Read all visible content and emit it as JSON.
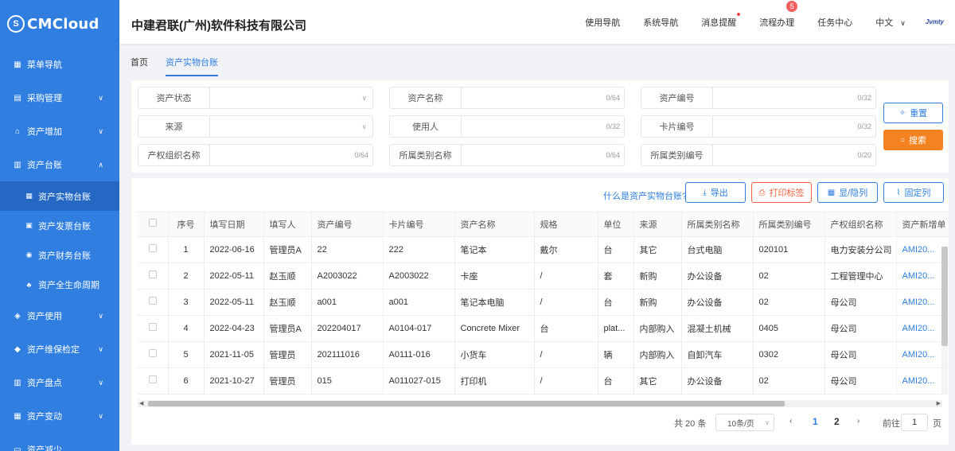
{
  "brand": {
    "logo_text": "CMCloud",
    "logo_mark": "S"
  },
  "sidebar": {
    "items": [
      {
        "label": "菜单导航",
        "icon": "grid-icon"
      },
      {
        "label": "采购管理",
        "icon": "clipboard-icon"
      },
      {
        "label": "资产增加",
        "icon": "home-icon"
      },
      {
        "label": "资产台账",
        "icon": "ledger-icon"
      },
      {
        "label": "资产使用",
        "icon": "layers-icon"
      },
      {
        "label": "资产维保检定",
        "icon": "cube-icon"
      },
      {
        "label": "资产盘点",
        "icon": "stack-icon"
      },
      {
        "label": "资产变动",
        "icon": "grid-icon"
      },
      {
        "label": "资产减少",
        "icon": "minus-icon"
      }
    ],
    "subitems": [
      {
        "label": "资产实物台账",
        "icon": "grid-icon",
        "active": true
      },
      {
        "label": "资产发票台账",
        "icon": "invoice-icon"
      },
      {
        "label": "资产财务台账",
        "icon": "money-icon"
      },
      {
        "label": "资产全生命周期",
        "icon": "tree-icon"
      }
    ]
  },
  "header": {
    "company": "中建君联(广州)软件科技有限公司",
    "nav": [
      "使用导航",
      "系统导航",
      "消息提醒",
      "流程办理",
      "任务中心"
    ],
    "process_badge": "5",
    "language": "中文",
    "partner_logo": "Jvmty"
  },
  "tabs": [
    "首页",
    "资产实物台账"
  ],
  "search": {
    "fields": [
      {
        "label": "资产状态",
        "type": "select"
      },
      {
        "label": "资产名称",
        "counter": "0/64"
      },
      {
        "label": "资产编号",
        "counter": "0/32"
      },
      {
        "label": "来源",
        "type": "select"
      },
      {
        "label": "使用人",
        "counter": "0/32"
      },
      {
        "label": "卡片编号",
        "counter": "0/32"
      },
      {
        "label": "产权组织名称",
        "counter": "0/64"
      },
      {
        "label": "所属类别名称",
        "counter": "0/64"
      },
      {
        "label": "所属类别编号",
        "counter": "0/20"
      }
    ],
    "reset_label": "重置",
    "search_label": "搜索"
  },
  "toolbar": {
    "help_link": "什么是资产实物台账?",
    "export_label": "导出",
    "print_label": "打印标签",
    "toggle_cols_label": "显/隐列",
    "fix_cols_label": "固定列"
  },
  "table": {
    "columns": [
      "序号",
      "填写日期",
      "填写人",
      "资产编号",
      "卡片编号",
      "资产名称",
      "规格",
      "单位",
      "来源",
      "所属类别名称",
      "所属类别编号",
      "产权组织名称",
      "资产新增单"
    ],
    "rows": [
      [
        "1",
        "2022-06-16",
        "管理员A",
        "22",
        "222",
        "笔记本",
        "戴尔",
        "台",
        "其它",
        "台式电脑",
        "020101",
        "电力安装分公司",
        "AMI20..."
      ],
      [
        "2",
        "2022-05-11",
        "赵玉顺",
        "A2003022",
        "A2003022",
        "卡座",
        "/",
        "套",
        "新购",
        "办公设备",
        "02",
        "工程管理中心",
        "AMI20..."
      ],
      [
        "3",
        "2022-05-11",
        "赵玉顺",
        "a001",
        "a001",
        "笔记本电脑",
        "/",
        "台",
        "新购",
        "办公设备",
        "02",
        "母公司",
        "AMI20..."
      ],
      [
        "4",
        "2022-04-23",
        "管理员A",
        "202204017",
        "A0104-017",
        "Concrete Mixer",
        "台",
        "plat...",
        "内部购入",
        "混凝土机械",
        "0405",
        "母公司",
        "AMI20..."
      ],
      [
        "5",
        "2021-11-05",
        "管理员",
        "202111016",
        "A0111-016",
        "小货车",
        "/",
        "辆",
        "内部购入",
        "自卸汽车",
        "0302",
        "母公司",
        "AMI20..."
      ],
      [
        "6",
        "2021-10-27",
        "管理员",
        "015",
        "A011027-015",
        "打印机",
        "/",
        "台",
        "其它",
        "办公设备",
        "02",
        "母公司",
        "AMI20..."
      ]
    ]
  },
  "pagination": {
    "total": "共 20 条",
    "page_size": "10条/页",
    "pages": [
      "1",
      "2"
    ],
    "current_page": "1",
    "goto_label": "前往",
    "goto_value": "1",
    "page_suffix": "页"
  },
  "colors": {
    "sidebar": "#2f7ee0",
    "accent": "#2f7ee0",
    "search_btn": "#f58220",
    "print_btn": "#f06040"
  }
}
